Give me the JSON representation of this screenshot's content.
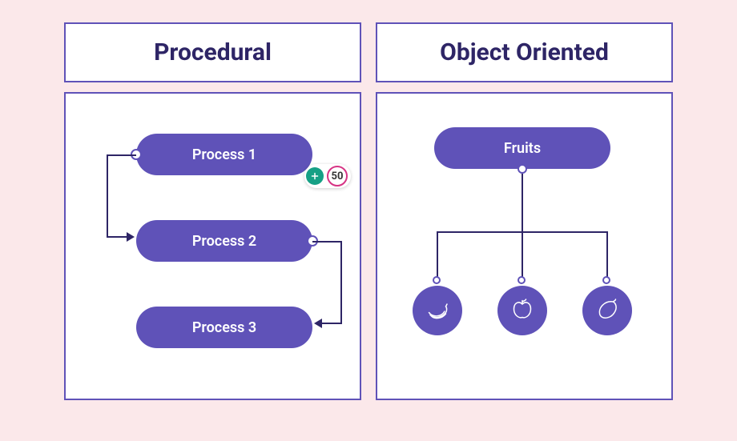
{
  "left": {
    "title": "Procedural",
    "steps": [
      "Process 1",
      "Process 2",
      "Process 3"
    ]
  },
  "right": {
    "title": "Object Oriented",
    "root": "Fruits",
    "children_icons": [
      "banana-icon",
      "apple-icon",
      "mango-icon"
    ]
  },
  "badge": {
    "value": "50"
  },
  "colors": {
    "background": "#fbe8ea",
    "panel": "#ffffff",
    "border": "#5f52b8",
    "pill": "#5f52b8",
    "heading": "#2e2566",
    "badge_accent": "#16a085",
    "badge_ring": "#d63384"
  }
}
